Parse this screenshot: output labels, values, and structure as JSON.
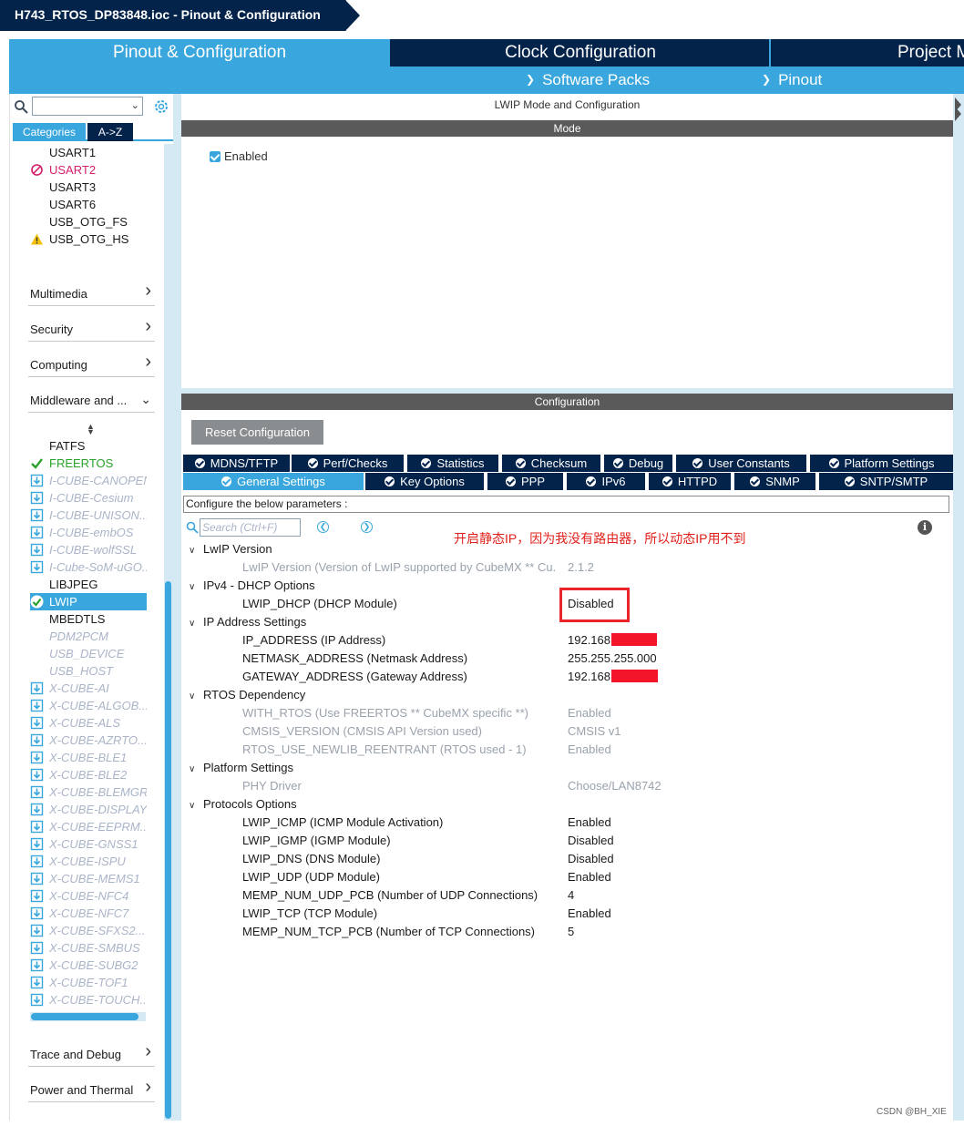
{
  "window": {
    "title": "H743_RTOS_DP83848.ioc - Pinout & Configuration"
  },
  "top_tabs": [
    {
      "label": "Pinout & Configuration",
      "active": true
    },
    {
      "label": "Clock Configuration",
      "active": false
    },
    {
      "label": "Project M",
      "active": false
    }
  ],
  "sub_menu": [
    {
      "label": "Software Packs"
    },
    {
      "label": "Pinout"
    }
  ],
  "left_panel": {
    "search_value": "",
    "view_tabs": [
      {
        "label": "Categories",
        "active": true
      },
      {
        "label": "A->Z",
        "active": false
      }
    ],
    "connectivity_items": [
      {
        "label": "USART1",
        "status": "none"
      },
      {
        "label": "USART2",
        "status": "disabled"
      },
      {
        "label": "USART3",
        "status": "none"
      },
      {
        "label": "USART6",
        "status": "none"
      },
      {
        "label": "USB_OTG_FS",
        "status": "none"
      },
      {
        "label": "USB_OTG_HS",
        "status": "warning"
      }
    ],
    "categories_top": [
      {
        "label": "Multimedia",
        "expanded": false
      },
      {
        "label": "Security",
        "expanded": false
      },
      {
        "label": "Computing",
        "expanded": false
      },
      {
        "label": "Middleware and ...",
        "expanded": true
      }
    ],
    "middleware_items": [
      {
        "label": "FATFS",
        "style": "normal"
      },
      {
        "label": "FREERTOS",
        "style": "green"
      },
      {
        "label": "I-CUBE-CANOPEN",
        "style": "dim-pack"
      },
      {
        "label": "I-CUBE-Cesium",
        "style": "dim-pack"
      },
      {
        "label": "I-CUBE-UNISON...",
        "style": "dim-pack"
      },
      {
        "label": "I-CUBE-embOS",
        "style": "dim-pack"
      },
      {
        "label": "I-CUBE-wolfSSL",
        "style": "dim-pack"
      },
      {
        "label": "I-Cube-SoM-uGO...",
        "style": "dim-pack"
      },
      {
        "label": "LIBJPEG",
        "style": "normal"
      },
      {
        "label": "LWIP",
        "style": "selected"
      },
      {
        "label": "MBEDTLS",
        "style": "normal"
      },
      {
        "label": "PDM2PCM",
        "style": "dim"
      },
      {
        "label": "USB_DEVICE",
        "style": "dim"
      },
      {
        "label": "USB_HOST",
        "style": "dim"
      },
      {
        "label": "X-CUBE-AI",
        "style": "dim-pack"
      },
      {
        "label": "X-CUBE-ALGOB...",
        "style": "dim-pack"
      },
      {
        "label": "X-CUBE-ALS",
        "style": "dim-pack"
      },
      {
        "label": "X-CUBE-AZRTO...",
        "style": "dim-pack"
      },
      {
        "label": "X-CUBE-BLE1",
        "style": "dim-pack"
      },
      {
        "label": "X-CUBE-BLE2",
        "style": "dim-pack"
      },
      {
        "label": "X-CUBE-BLEMGR",
        "style": "dim-pack"
      },
      {
        "label": "X-CUBE-DISPLAY",
        "style": "dim-pack"
      },
      {
        "label": "X-CUBE-EEPRM...",
        "style": "dim-pack"
      },
      {
        "label": "X-CUBE-GNSS1",
        "style": "dim-pack"
      },
      {
        "label": "X-CUBE-ISPU",
        "style": "dim-pack"
      },
      {
        "label": "X-CUBE-MEMS1",
        "style": "dim-pack"
      },
      {
        "label": "X-CUBE-NFC4",
        "style": "dim-pack"
      },
      {
        "label": "X-CUBE-NFC7",
        "style": "dim-pack"
      },
      {
        "label": "X-CUBE-SFXS2...",
        "style": "dim-pack"
      },
      {
        "label": "X-CUBE-SMBUS",
        "style": "dim-pack"
      },
      {
        "label": "X-CUBE-SUBG2",
        "style": "dim-pack"
      },
      {
        "label": "X-CUBE-TOF1",
        "style": "dim-pack"
      },
      {
        "label": "X-CUBE-TOUCH...",
        "style": "dim-pack"
      }
    ],
    "categories_bottom": [
      {
        "label": "Trace and Debug",
        "expanded": false
      },
      {
        "label": "Power and Thermal",
        "expanded": false
      }
    ]
  },
  "mode": {
    "header": "LWIP Mode and Configuration",
    "bar_label": "Mode",
    "enabled_label": "Enabled",
    "enabled_checked": true
  },
  "configuration": {
    "bar_label": "Configuration",
    "reset_button": "Reset Configuration",
    "tabs_row1": [
      "MDNS/TFTP",
      "Perf/Checks",
      "Statistics",
      "Checksum",
      "Debug",
      "User Constants",
      "Platform Settings"
    ],
    "tabs_row2": [
      "General Settings",
      "Key Options",
      "PPP",
      "IPv6",
      "HTTPD",
      "SNMP",
      "SNTP/SMTP"
    ],
    "active_tab": "General Settings",
    "configure_text": "Configure the below parameters :",
    "search_placeholder": "Search (Ctrl+F)",
    "annotation": "开启静态IP，因为我没有路由器，所以动态IP用不到",
    "groups": [
      {
        "title": "LwIP Version",
        "params": [
          {
            "name": "LwIP Version (Version of LwIP supported by CubeMX ** Cu...",
            "value": "2.1.2",
            "dim": true
          }
        ]
      },
      {
        "title": "IPv4 - DHCP Options",
        "params": [
          {
            "name": "LWIP_DHCP (DHCP Module)",
            "value": "Disabled",
            "dim": false
          }
        ]
      },
      {
        "title": "IP Address Settings",
        "params": [
          {
            "name": "IP_ADDRESS (IP Address)",
            "value": "192.168",
            "dim": false
          },
          {
            "name": "NETMASK_ADDRESS (Netmask Address)",
            "value": "255.255.255.000",
            "dim": false
          },
          {
            "name": "GATEWAY_ADDRESS (Gateway Address)",
            "value": "192.168",
            "dim": false
          }
        ]
      },
      {
        "title": "RTOS Dependency",
        "params": [
          {
            "name": "WITH_RTOS (Use FREERTOS ** CubeMX specific **)",
            "value": "Enabled",
            "dim": true
          },
          {
            "name": "CMSIS_VERSION (CMSIS API Version used)",
            "value": "CMSIS v1",
            "dim": true
          },
          {
            "name": "RTOS_USE_NEWLIB_REENTRANT (RTOS used - 1)",
            "value": "Enabled",
            "dim": true
          }
        ]
      },
      {
        "title": "Platform Settings",
        "params": [
          {
            "name": "PHY Driver",
            "value": "Choose/LAN8742",
            "dim": true
          }
        ]
      },
      {
        "title": "Protocols Options",
        "params": [
          {
            "name": "LWIP_ICMP (ICMP Module Activation)",
            "value": "Enabled",
            "dim": false
          },
          {
            "name": "LWIP_IGMP (IGMP Module)",
            "value": "Disabled",
            "dim": false
          },
          {
            "name": "LWIP_DNS (DNS Module)",
            "value": "Disabled",
            "dim": false
          },
          {
            "name": "LWIP_UDP (UDP Module)",
            "value": "Enabled",
            "dim": false
          },
          {
            "name": "MEMP_NUM_UDP_PCB (Number of UDP Connections)",
            "value": "4",
            "dim": false
          },
          {
            "name": "LWIP_TCP (TCP Module)",
            "value": "Enabled",
            "dim": false
          },
          {
            "name": "MEMP_NUM_TCP_PCB (Number of TCP Connections)",
            "value": "5",
            "dim": false
          }
        ]
      }
    ]
  },
  "watermark": "CSDN @BH_XIE",
  "colors": {
    "navy": "#03234b",
    "accent": "#39a7dd",
    "highlight_red": "#e8262b",
    "annotation_red": "#e0211b"
  }
}
